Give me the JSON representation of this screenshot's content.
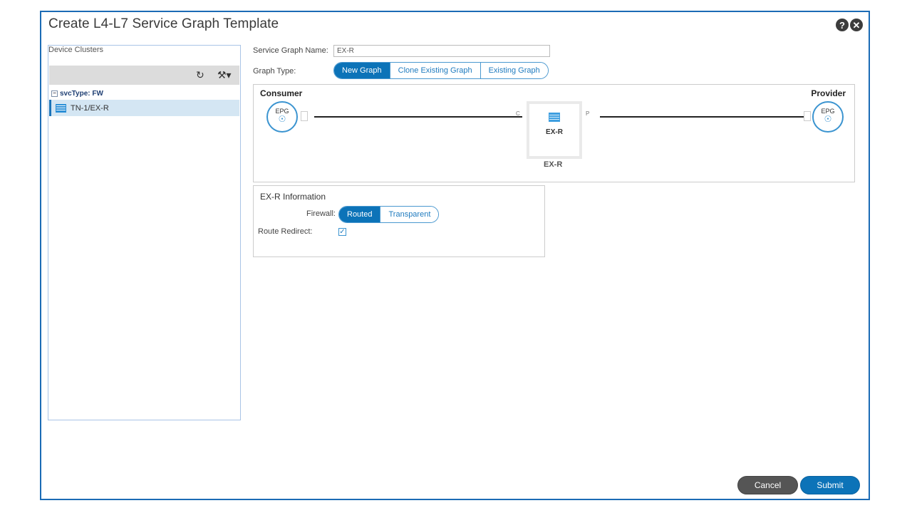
{
  "dialog": {
    "title": "Create L4-L7 Service Graph Template",
    "help_label": "?",
    "close_label": "✕"
  },
  "left_panel": {
    "title": "Device Clusters",
    "toolbar": {
      "refresh_icon": "refresh-icon",
      "tools_icon": "tools-icon"
    },
    "tree": {
      "group_label": "svcType: FW",
      "items": [
        {
          "label": "TN-1/EX-R",
          "icon": "firewall-icon"
        }
      ]
    }
  },
  "form": {
    "name_label": "Service Graph Name:",
    "name_value": "EX-R",
    "type_label": "Graph Type:",
    "graph_type_options": [
      "New Graph",
      "Clone Existing Graph",
      "Existing Graph"
    ],
    "graph_type_selected": "New Graph"
  },
  "graph": {
    "consumer_label": "Consumer",
    "provider_label": "Provider",
    "consumer_epg": "EPG",
    "provider_epg": "EPG",
    "node_name": "EX-R",
    "node_caption": "EX-R",
    "c_label": "C",
    "p_label": "P"
  },
  "info": {
    "title": "EX-R Information",
    "firewall_label": "Firewall:",
    "firewall_options": [
      "Routed",
      "Transparent"
    ],
    "firewall_selected": "Routed",
    "route_redirect_label": "Route Redirect:",
    "route_redirect_checked": true
  },
  "footer": {
    "cancel_label": "Cancel",
    "submit_label": "Submit"
  },
  "colors": {
    "accent": "#0c73b8",
    "frame": "#1b6bb5",
    "cancel": "#555555"
  }
}
